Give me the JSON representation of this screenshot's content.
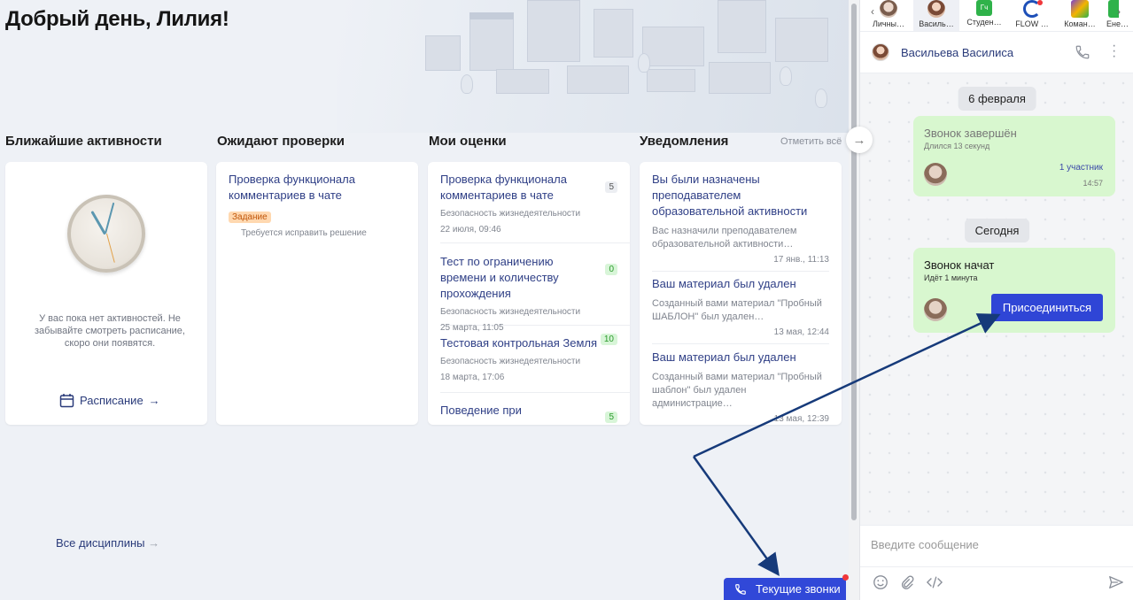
{
  "greeting": "Добрый день, Лилия!",
  "columns": {
    "activities": {
      "title": "Ближайшие активности",
      "empty_text": "У вас пока нет активностей. Не забывайте смотреть расписание, скоро они появятся.",
      "schedule_link": "Расписание"
    },
    "review": {
      "title": "Ожидают проверки",
      "items": [
        {
          "title": "Проверка функционала комментариев в чате",
          "tag": "Задание",
          "hint": "Требуется исправить решение"
        }
      ]
    },
    "grades": {
      "title": "Мои оценки",
      "items": [
        {
          "title": "Проверка функционала комментариев в чате",
          "subject": "Безопасность жизнедеятельности",
          "date": "22 июля, 09:46",
          "grade": "5",
          "grade_color": "grey"
        },
        {
          "title": "Тест по ограничению времени и количеству прохождения",
          "subject": "Безопасность жизнедеятельности",
          "date": "25 марта, 11:05",
          "grade": "0",
          "grade_color": "green"
        },
        {
          "title": "Тестовая контрольная Земля",
          "subject": "Безопасность жизнедеятельности",
          "date": "18 марта, 17:06",
          "grade": "10",
          "grade_color": "green"
        },
        {
          "title": "Поведение при",
          "subject": "",
          "date": "",
          "grade": "5",
          "grade_color": "green"
        }
      ]
    },
    "notifications": {
      "title": "Уведомления",
      "mark_all": "Отметить всё",
      "items": [
        {
          "title": "Вы были назначены преподавателем образовательной активности",
          "body": "Вас назначили преподавателем образовательной активности…",
          "time": "17 янв., 11:13"
        },
        {
          "title": "Ваш материал был удален",
          "body": "Созданный вами материал \"Пробный ШАБЛОН\" был удален…",
          "time": "13 мая, 12:44"
        },
        {
          "title": "Ваш материал был удален",
          "body": "Созданный вами материал \"Пробный шаблон\" был удален администрацие…",
          "time": "13 мая, 12:39"
        }
      ]
    }
  },
  "all_disciplines": "Все дисциплины",
  "current_calls_button": "Текущие звонки",
  "chat": {
    "tabs": [
      {
        "label": "Личны…",
        "kind": "avatar"
      },
      {
        "label": "Василь…",
        "kind": "avatar"
      },
      {
        "label": "Студен…",
        "kind": "green",
        "initials": "Гч"
      },
      {
        "label": "FLOW …",
        "kind": "flow"
      },
      {
        "label": "Коман…",
        "kind": "team"
      },
      {
        "label": "Ене…",
        "kind": "avatar"
      }
    ],
    "header_name": "Васильева Василиса",
    "messages": {
      "date1": "6 февраля",
      "call_ended": {
        "title": "Звонок завершён",
        "duration": "Длился 13 секунд",
        "participants": "1 участник",
        "time": "14:57"
      },
      "date2": "Сегодня",
      "call_started": {
        "title": "Звонок начат",
        "duration": "Идёт 1 минута",
        "join_label": "Присоединиться"
      }
    },
    "input_placeholder": "Введите сообщение"
  },
  "colors": {
    "accent": "#3148d8",
    "link": "#2f3f86",
    "bubble": "#d8f7cf",
    "tag_bg": "#ffd8b0"
  }
}
